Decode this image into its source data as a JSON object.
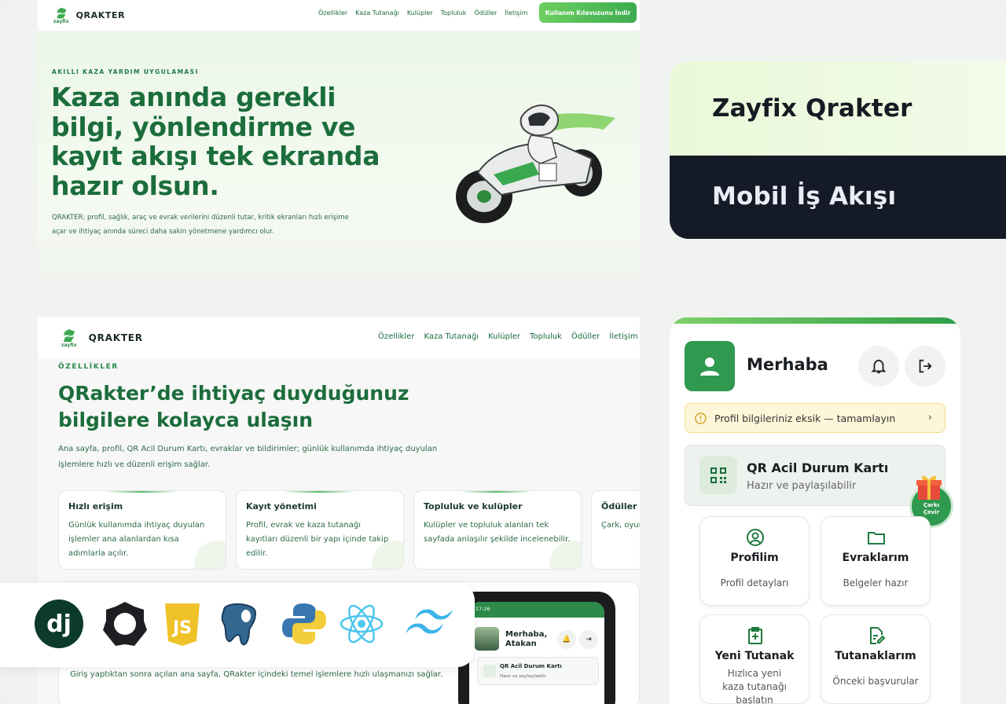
{
  "hero": {
    "brand": "QRAKTER",
    "logo_sub": "zayfix",
    "nav": [
      "Özellikler",
      "Kaza Tutanağı",
      "Kulüpler",
      "Topluluk",
      "Ödüller",
      "İletişim"
    ],
    "cta": "Kullanım Kılavuzunu İndir",
    "eyebrow": "AKILLI KAZA YARDIM UYGULAMASI",
    "title": "Kaza anında gerekli bilgi, yönlendirme ve kayıt akışı tek ekranda hazır olsun.",
    "description": "QRAKTER; profil, sağlık, araç ve evrak verilerini düzenli tutar, kritik ekranları hızlı erişime açar ve ihtiyaç anında süreci daha sakin yönetmene yardımcı olur."
  },
  "titles": {
    "top": "Zayfix Qrakter",
    "bottom": "Mobil İş Akışı"
  },
  "features": {
    "brand": "QRAKTER",
    "logo_sub": "zayfix",
    "nav": [
      "Özellikler",
      "Kaza Tutanağı",
      "Kulüpler",
      "Topluluk",
      "Ödüller",
      "İletişim"
    ],
    "eyebrow": "ÖZELLİKLER",
    "title": "QRakter’de ihtiyaç duyduğunuz bilgilere kolayca ulaşın",
    "description": "Ana sayfa, profil, QR Acil Durum Kartı, evraklar ve bildirimler; günlük kullanımda ihtiyaç duyulan işlemlere hızlı ve düzenli erişim sağlar.",
    "cards": [
      {
        "title": "Hızlı erişim",
        "text": "Günlük kullanımda ihtiyaç duyulan işlemler ana alanlardan kısa adımlarla açılır."
      },
      {
        "title": "Kayıt yönetimi",
        "text": "Profil, evrak ve kaza tutanağı kayıtları düzenli bir yapı içinde takip edilir."
      },
      {
        "title": "Topluluk ve kulüpler",
        "text": "Kulüpler ve topluluk alanları tek sayfada anlaşılır şekilde incelenebilir."
      },
      {
        "title": "Ödüller ve",
        "text": "Çark, oyun kampanya görüntüle"
      }
    ],
    "lower_text": "Giriş yaptıktan sonra açılan ana sayfa, QRakter içindeki temel işlemlere hızlı ulaşmanızı sağlar."
  },
  "phone": {
    "time": "17:26",
    "hello": "Merhaba, Atakan",
    "qr_title": "QR Acil Durum Kartı",
    "qr_sub": "Hazır ve paylaşılabilir"
  },
  "tech": [
    "django-icon",
    "gear-icon",
    "javascript-icon",
    "postgresql-icon",
    "python-icon",
    "react-icon",
    "tailwind-icon"
  ],
  "app": {
    "hello": "Merhaba",
    "warning": "Profil bilgileriniz eksik — tamamlayın",
    "qr_title": "QR Acil Durum Kartı",
    "qr_sub": "Hazır ve paylaşılabilir",
    "wheel": [
      "Çarkı",
      "Çevir"
    ],
    "tiles": [
      {
        "title": "Profilim",
        "text": "Profil detayları"
      },
      {
        "title": "Evraklarım",
        "text": "Belgeler hazır"
      },
      {
        "title": "Yeni Tutanak",
        "text": "Hızlıca yeni kaza tutanağı başlatın"
      },
      {
        "title": "Tutanaklarım",
        "text": "Önceki başvurular"
      }
    ]
  },
  "colors": {
    "brand_green": "#2f9a4f",
    "dark_title": "#1c6d3c",
    "dark_card": "#151b26",
    "warning_bg": "#fdf6d9"
  }
}
